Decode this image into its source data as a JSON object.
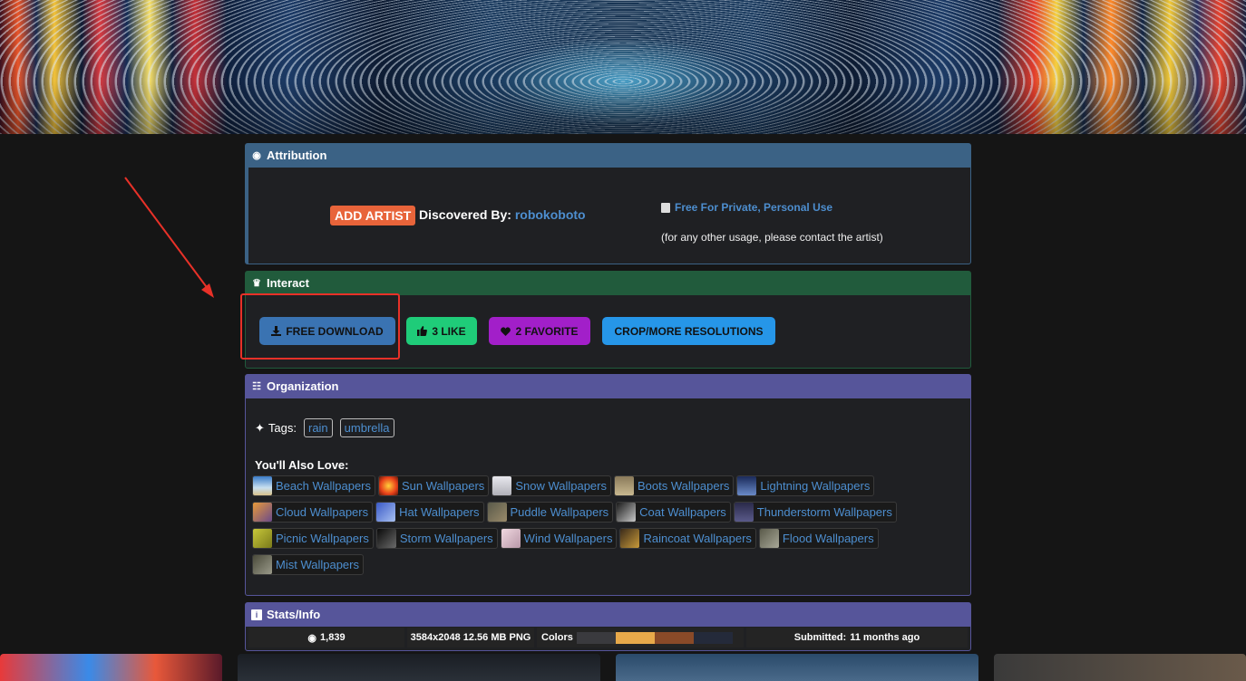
{
  "attribution": {
    "title": "Attribution",
    "add_artist_label": "ADD ARTIST",
    "discovered_by_label": "Discovered By:",
    "discoverer": "robokoboto",
    "license": "Free For Private, Personal Use",
    "license_note": "(for any other usage, please contact the artist)"
  },
  "interact": {
    "title": "Interact",
    "download_label": "FREE DOWNLOAD",
    "like_label": "3 LIKE",
    "favorite_label": "2 FAVORITE",
    "crop_label": "CROP/MORE RESOLUTIONS"
  },
  "organization": {
    "title": "Organization",
    "tags_label": "Tags:",
    "tags": [
      "rain",
      "umbrella"
    ],
    "also_love_label": "You'll Also Love:",
    "related": [
      "Beach Wallpapers",
      "Sun Wallpapers",
      "Snow Wallpapers",
      "Boots Wallpapers",
      "Lightning Wallpapers",
      "Cloud Wallpapers",
      "Hat Wallpapers",
      "Puddle Wallpapers",
      "Coat Wallpapers",
      "Thunderstorm Wallpapers",
      "Picnic Wallpapers",
      "Storm Wallpapers",
      "Wind Wallpapers",
      "Raincoat Wallpapers",
      "Flood Wallpapers",
      "Mist Wallpapers"
    ]
  },
  "stats": {
    "title": "Stats/Info",
    "views": "1,839",
    "file_info": "3584x2048 12.56 MB PNG",
    "colors_label": "Colors",
    "colors": [
      "#3a3a3e",
      "#e8a94a",
      "#8a4a28",
      "#242a3a"
    ],
    "submitted_label": "Submitted:",
    "submitted_value": "11 months ago"
  },
  "colors": {
    "attribution_header": "#3b6285",
    "interact_header": "#215b3c",
    "organization_header": "#56559a",
    "link": "#4d8ecf",
    "highlight": "#e83128"
  }
}
